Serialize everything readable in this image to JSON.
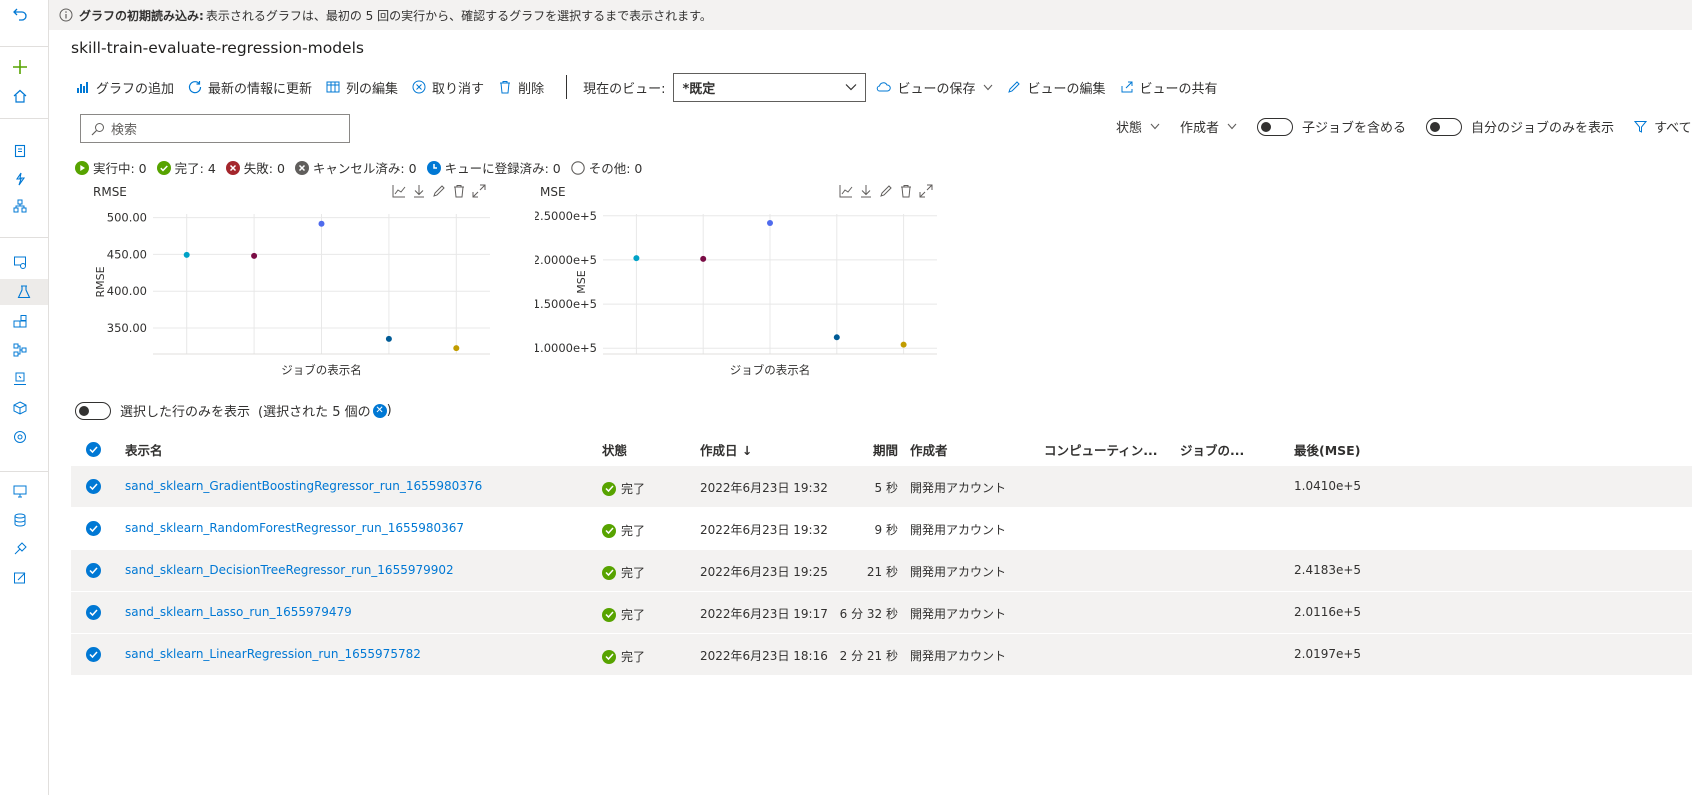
{
  "banner": {
    "title": "グラフの初期読み込み:",
    "text": "表示されるグラフは、最初の 5 回の実行から、確認するグラフを選択するまで表示されます。"
  },
  "page_title": "skill-train-evaluate-regression-models",
  "toolbar": {
    "add_chart": "グラフの追加",
    "refresh": "最新の情報に更新",
    "edit_columns": "列の編集",
    "cancel": "取り消す",
    "delete": "削除",
    "current_view_label": "現在のビュー:",
    "current_view_value": "*既定",
    "save_view": "ビューの保存",
    "edit_view": "ビューの編集",
    "share_view": "ビューの共有"
  },
  "search": {
    "placeholder": "検索"
  },
  "filters": {
    "status": "状態",
    "created_by": "作成者",
    "include_child_jobs": "子ジョブを含める",
    "only_my_jobs": "自分のジョブのみを表示",
    "all_filters": "すべての"
  },
  "status_counts": {
    "running": "実行中: 0",
    "completed": "完了: 4",
    "failed": "失敗: 0",
    "canceled": "キャンセル済み: 0",
    "queued": "キューに登録済み: 0",
    "other": "その他: 0"
  },
  "colors": {
    "accent": "#0078d4",
    "success": "#57a300",
    "failed": "#a4262c",
    "canceled": "#605e5c",
    "series": [
      "#00a2c7",
      "#7a0c45",
      "#4f6bed",
      "#005b96",
      "#c19c00"
    ]
  },
  "chart_data": [
    {
      "type": "scatter",
      "title": "RMSE",
      "ylabel": "RMSE",
      "xlabel": "ジョブの表示名",
      "ylim": [
        320,
        505
      ],
      "yticks": [
        "500.00",
        "450.00",
        "400.00",
        "350.00"
      ],
      "ytick_values": [
        500,
        450,
        400,
        350
      ],
      "grid": true,
      "values": [
        449.4,
        448.0,
        491.8,
        335.2,
        322.6
      ]
    },
    {
      "type": "scatter",
      "title": "MSE",
      "ylabel": "MSE",
      "xlabel": "ジョブの表示名",
      "ylim": [
        98000,
        252000
      ],
      "yticks": [
        "2.5000e+5",
        "2.0000e+5",
        "1.5000e+5",
        "1.0000e+5"
      ],
      "ytick_values": [
        250000,
        200000,
        150000,
        100000
      ],
      "grid": true,
      "values": [
        201970,
        201160,
        241830,
        112370,
        104100
      ]
    }
  ],
  "selection": {
    "toggle_label": "選択した行のみを表示",
    "selected_info": "(選択された 5 個の",
    "close_paren": ")"
  },
  "table": {
    "headers": {
      "display_name": "表示名",
      "status": "状態",
      "created": "作成日 ↓",
      "duration": "期間",
      "created_by": "作成者",
      "compute": "コンピューティン...",
      "job_type": "ジョブの...",
      "last_mse": "最後(MSE)"
    },
    "rows": [
      {
        "name": "sand_sklearn_GradientBoostingRegressor_run_1655980376",
        "status": "完了",
        "created": "2022年6月23日 19:32",
        "duration": "5 秒",
        "created_by": "開発用アカウント",
        "mse": "1.0410e+5"
      },
      {
        "name": "sand_sklearn_RandomForestRegressor_run_1655980367",
        "status": "完了",
        "created": "2022年6月23日 19:32",
        "duration": "9 秒",
        "created_by": "開発用アカウント",
        "mse": ""
      },
      {
        "name": "sand_sklearn_DecisionTreeRegressor_run_1655979902",
        "status": "完了",
        "created": "2022年6月23日 19:25",
        "duration": "21 秒",
        "created_by": "開発用アカウント",
        "mse": "2.4183e+5"
      },
      {
        "name": "sand_sklearn_Lasso_run_1655979479",
        "status": "完了",
        "created": "2022年6月23日 19:17",
        "duration": "6 分 32 秒",
        "created_by": "開発用アカウント",
        "mse": "2.0116e+5"
      },
      {
        "name": "sand_sklearn_LinearRegression_run_1655975782",
        "status": "完了",
        "created": "2022年6月23日 18:16",
        "duration": "2 分 21 秒",
        "created_by": "開発用アカウント",
        "mse": "2.0197e+5"
      }
    ]
  }
}
